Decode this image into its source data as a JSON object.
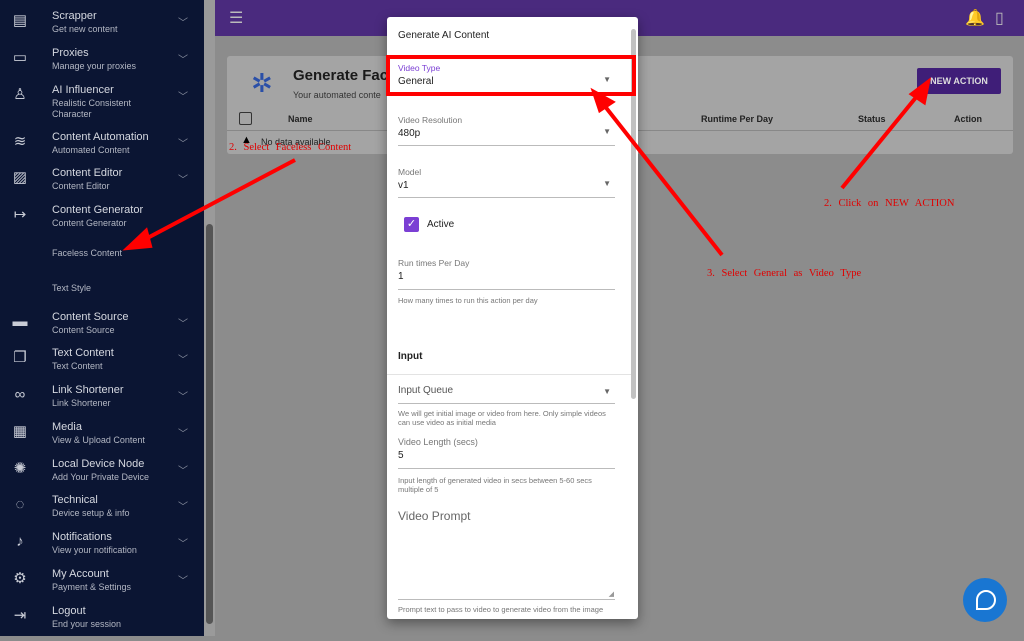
{
  "sidebar": {
    "items": [
      {
        "title": "Scrapper",
        "sub": "Get new content",
        "icon": "article-icon"
      },
      {
        "title": "Proxies",
        "sub": "Manage your proxies",
        "icon": "proxy-icon"
      },
      {
        "title": "AI Influencer",
        "sub": "Realistic Consistent Character",
        "icon": "person-icon"
      },
      {
        "title": "Content Automation",
        "sub": "Automated Content",
        "icon": "waves-icon"
      },
      {
        "title": "Content Editor",
        "sub": "Content Editor",
        "icon": "image-icon"
      },
      {
        "title": "Content Generator",
        "sub": "Content Generator",
        "icon": "arrow-right-icon"
      },
      {
        "title": "Content Source",
        "sub": "Content Source",
        "icon": "folder-icon"
      },
      {
        "title": "Text Content",
        "sub": "Text Content",
        "icon": "copy-icon"
      },
      {
        "title": "Link Shortener",
        "sub": "Link Shortener",
        "icon": "link-icon"
      },
      {
        "title": "Media",
        "sub": "View & Upload Content",
        "icon": "movie-icon"
      },
      {
        "title": "Local Device Node",
        "sub": "Add Your Private Device",
        "icon": "hub-icon"
      },
      {
        "title": "Technical",
        "sub": "Device setup & info",
        "icon": "circle-icon"
      },
      {
        "title": "Notifications",
        "sub": "View your notification",
        "icon": "bell-icon"
      },
      {
        "title": "My Account",
        "sub": "Payment & Settings",
        "icon": "gear-icon"
      },
      {
        "title": "Logout",
        "sub": "End your session",
        "icon": "logout-icon"
      }
    ],
    "subitems": [
      "Faceless Content",
      "Text Style"
    ]
  },
  "page": {
    "title": "Generate Face",
    "subtitle": "Your automated conte",
    "headers": [
      "Name",
      "Runtime Per Day",
      "Status",
      "Action"
    ],
    "empty": "No data available",
    "new_action": "NEW ACTION"
  },
  "modal": {
    "title": "Generate AI Content",
    "video_type": {
      "label": "Video Type",
      "value": "General"
    },
    "video_resolution": {
      "label": "Video Resolution",
      "value": "480p"
    },
    "model": {
      "label": "Model",
      "value": "v1"
    },
    "active": "Active",
    "run_times": {
      "label": "Run times Per Day",
      "value": "1",
      "hint": "How many times to run this action per day"
    },
    "input_section": "Input",
    "input_queue": {
      "placeholder": "Input Queue",
      "hint": "We will get initial image or video from here. Only simple videos can use video as initial media"
    },
    "video_length": {
      "label": "Video Length (secs)",
      "value": "5",
      "hint": "Input length of generated video in secs between 5-60 secs multiple of 5"
    },
    "video_prompt": {
      "placeholder": "Video Prompt",
      "hint": "Prompt text to pass to video to generate video from the image"
    }
  },
  "annotations": {
    "a1": "2. Select Faceless Content",
    "a2": "2. Click on NEW ACTION",
    "a3": "3. Select General as Video Type"
  }
}
